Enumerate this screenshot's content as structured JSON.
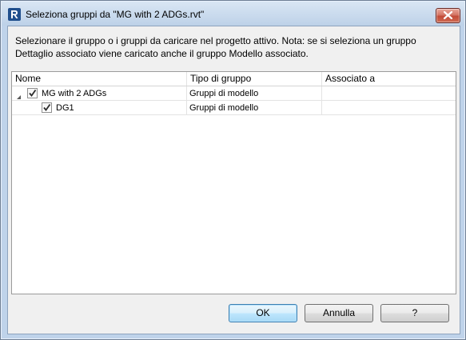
{
  "window": {
    "title": "Seleziona gruppi da \"MG with 2 ADGs.rvt\"",
    "app_icon": "revit-logo-icon",
    "close_icon": "close-icon"
  },
  "message": {
    "line1": "Selezionare il gruppo o i gruppi da caricare nel progetto attivo. Nota: se si seleziona un gruppo",
    "line2": "Dettaglio associato viene caricato anche il gruppo Modello associato."
  },
  "grid": {
    "columns": [
      "Nome",
      "Tipo di gruppo",
      "Associato a"
    ],
    "rows": [
      {
        "name": "MG with 2 ADGs",
        "type": "Gruppi di modello",
        "associated": "",
        "checked": true,
        "expanded": true,
        "level": 0
      },
      {
        "name": "DG1",
        "type": "Gruppi di modello",
        "associated": "",
        "checked": true,
        "expanded": false,
        "level": 1
      }
    ]
  },
  "buttons": {
    "ok": "OK",
    "cancel": "Annulla",
    "help": "?"
  },
  "colors": {
    "title_bar": "#bfd3ea",
    "client_bg": "#f0f0f0",
    "close_button": "#c24b38",
    "default_button": "#3c7fb1"
  }
}
